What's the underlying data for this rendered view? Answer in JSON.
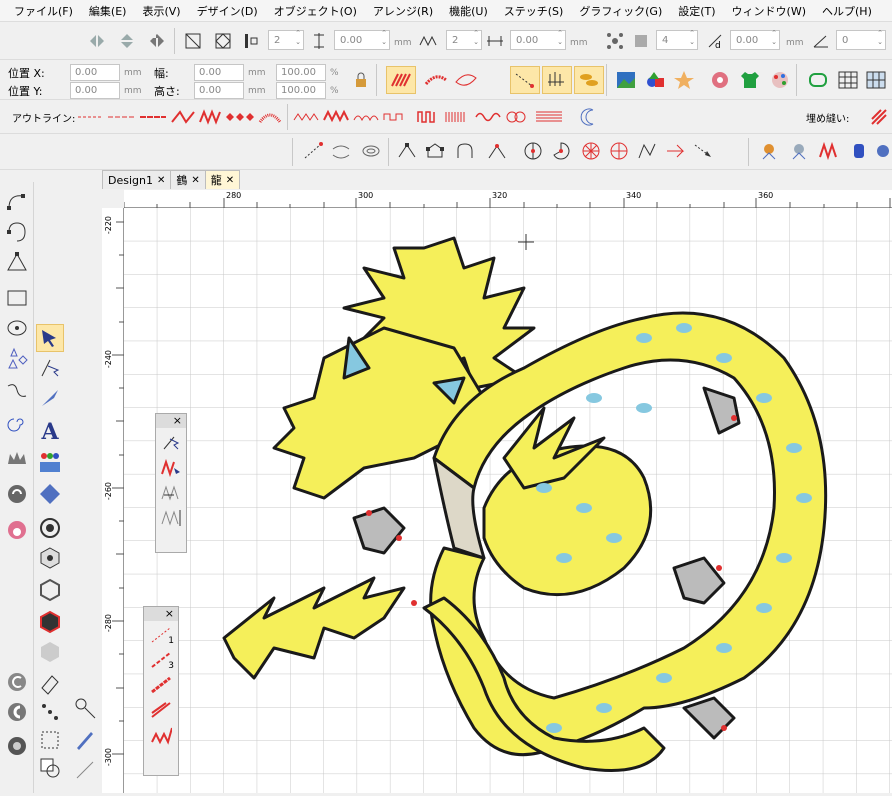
{
  "menu": [
    "ファイル(F)",
    "編集(E)",
    "表示(V)",
    "デザイン(D)",
    "オブジェクト(O)",
    "アレンジ(R)",
    "機能(U)",
    "ステッチ(S)",
    "グラフィック(G)",
    "設定(T)",
    "ウィンドウ(W)",
    "ヘルプ(H)"
  ],
  "toolbar1": {
    "count1": "2",
    "val1": "0.00",
    "unit": "mm",
    "count2": "2",
    "val2": "0.00",
    "count3": "4",
    "val3": "0.00",
    "val4": "0"
  },
  "position": {
    "x_label": "位置 X:",
    "y_label": "位置 Y:",
    "x_value": "0.00",
    "y_value": "0.00",
    "w_label": "幅:",
    "h_label": "高さ:",
    "w_value": "0.00",
    "h_value": "0.00",
    "w_pct": "100.00",
    "h_pct": "100.00",
    "unit": "mm",
    "pct": "%"
  },
  "outline_label": "アウトライン:",
  "fill_label": "埋め縫い:",
  "tabs": [
    {
      "label": "Design1",
      "active": false
    },
    {
      "label": "鶴",
      "active": false
    },
    {
      "label": "龍",
      "active": true
    }
  ],
  "ruler": {
    "h_labels": [
      "280",
      "300",
      "320",
      "340",
      "360"
    ],
    "v_labels": [
      "-220",
      "-240",
      "-260",
      "-280",
      "-300"
    ]
  },
  "float1": {
    "close": "×"
  },
  "float2": {
    "close": "×",
    "item1": "1",
    "item2": "3"
  },
  "colors": {
    "accent": "#fde7a8",
    "dragon_yellow": "#f5ef5a",
    "scale_blue": "#86c8e0",
    "outline": "#1a1a1a",
    "red": "#e03030"
  }
}
